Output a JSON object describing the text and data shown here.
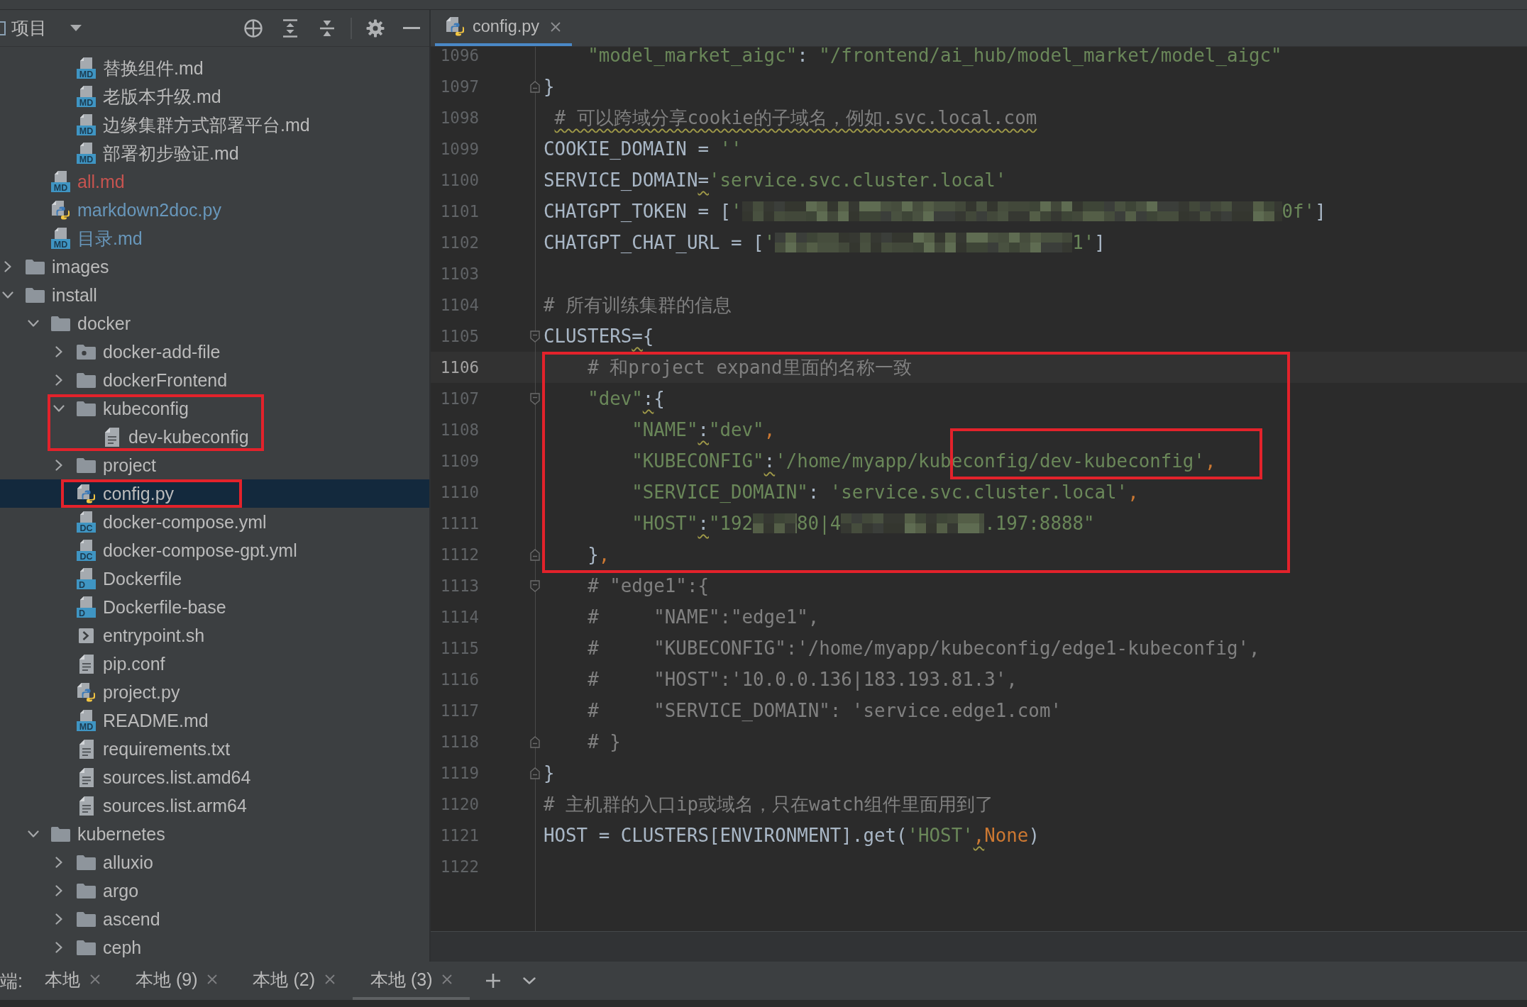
{
  "project_panel": {
    "title": "项目",
    "tree": [
      {
        "children": [
          {
            "children": [
              {
                "label": "替换组件.md",
                "kind": "md",
                "badge": "MD",
                "selected": false
              },
              {
                "label": "老版本升级.md",
                "kind": "md",
                "badge": "MD",
                "selected": false
              },
              {
                "label": "边缘集群方式部署平台.md",
                "kind": "md",
                "badge": "MD",
                "selected": false
              },
              {
                "label": "部署初步验证.md",
                "kind": "md",
                "badge": "MD",
                "selected": false
              }
            ]
          },
          {
            "label": "all.md",
            "kind": "md",
            "badge": "MD",
            "color": "#c75450",
            "selected": false
          },
          {
            "label": "markdown2doc.py",
            "kind": "py",
            "color": "#6897bb",
            "selected": false
          },
          {
            "label": "目录.md",
            "kind": "md",
            "badge": "MD",
            "color": "#6897bb",
            "selected": false
          }
        ]
      },
      {
        "label": "images",
        "kind": "folder",
        "expanded": false,
        "selected": false
      },
      {
        "label": "install",
        "kind": "folder",
        "expanded": true,
        "selected": false,
        "children": [
          {
            "label": "docker",
            "kind": "folder",
            "expanded": true,
            "selected": false,
            "children": [
              {
                "label": "docker-add-file",
                "kind": "folder-resource",
                "expanded": false,
                "selected": false
              },
              {
                "label": "dockerFrontend",
                "kind": "folder",
                "expanded": false,
                "selected": false
              },
              {
                "label": "kubeconfig",
                "kind": "folder",
                "expanded": true,
                "selected": false,
                "boxed": true,
                "children": [
                  {
                    "label": "dev-kubeconfig",
                    "kind": "text",
                    "selected": false
                  }
                ]
              },
              {
                "label": "project",
                "kind": "folder",
                "expanded": false,
                "selected": false
              },
              {
                "label": "config.py",
                "kind": "py",
                "selected": true,
                "boxed": true
              },
              {
                "label": "docker-compose.yml",
                "kind": "dc",
                "badge": "DC",
                "selected": false
              },
              {
                "label": "docker-compose-gpt.yml",
                "kind": "dc",
                "badge": "DC",
                "selected": false
              },
              {
                "label": "Dockerfile",
                "kind": "docker",
                "badge": "D",
                "selected": false
              },
              {
                "label": "Dockerfile-base",
                "kind": "docker",
                "badge": "D",
                "selected": false
              },
              {
                "label": "entrypoint.sh",
                "kind": "shell",
                "selected": false
              },
              {
                "label": "pip.conf",
                "kind": "text",
                "selected": false
              },
              {
                "label": "project.py",
                "kind": "py",
                "selected": false
              },
              {
                "label": "README.md",
                "kind": "md",
                "badge": "MD",
                "selected": false
              },
              {
                "label": "requirements.txt",
                "kind": "text",
                "selected": false
              },
              {
                "label": "sources.list.amd64",
                "kind": "text",
                "selected": false
              },
              {
                "label": "sources.list.arm64",
                "kind": "text",
                "selected": false
              }
            ]
          },
          {
            "label": "kubernetes",
            "kind": "folder",
            "expanded": true,
            "selected": false,
            "children": [
              {
                "label": "alluxio",
                "kind": "folder",
                "expanded": false,
                "selected": false
              },
              {
                "label": "argo",
                "kind": "folder",
                "expanded": false,
                "selected": false
              },
              {
                "label": "ascend",
                "kind": "folder",
                "expanded": false,
                "selected": false
              },
              {
                "label": "ceph",
                "kind": "folder",
                "expanded": false,
                "selected": false
              }
            ]
          }
        ]
      }
    ]
  },
  "editor": {
    "tabs": [
      {
        "label": "config.py",
        "kind": "py",
        "selected": true
      }
    ],
    "blocks": [
      {
        "lines": [
          {
            "number": "1096",
            "current": false,
            "tokens": [
              {
                "kind": "string",
                "text": "    \"model_market_aigc\""
              },
              {
                "kind": "plain",
                "text": ": "
              },
              {
                "kind": "string",
                "text": "\"/frontend/ai_hub/model_market/model_aigc\""
              }
            ]
          },
          {
            "number": "1097",
            "current": false,
            "fold_end": true,
            "tokens": [
              {
                "kind": "plain",
                "text": "}"
              }
            ]
          },
          {
            "number": "1098",
            "current": false,
            "tokens": [
              {
                "kind": "comment",
                "text": " # 可以跨域分享cookie的子域名，例如.svc.local.com",
                "warning": true
              }
            ]
          },
          {
            "number": "1099",
            "current": false,
            "tokens": [
              {
                "kind": "plain",
                "text": "COOKIE_DOMAIN = "
              },
              {
                "kind": "string",
                "text": "''"
              }
            ]
          },
          {
            "number": "1100",
            "current": false,
            "tokens": [
              {
                "kind": "plain",
                "text": "SERVICE_DOMAIN"
              },
              {
                "kind": "plain",
                "text": "=",
                "warning": true
              },
              {
                "kind": "string",
                "text": "'service.svc.cluster.local'"
              }
            ]
          },
          {
            "number": "1101",
            "current": false,
            "tokens": [
              {
                "kind": "plain",
                "text": "CHATGPT_TOKEN = ["
              },
              {
                "kind": "string",
                "text": "'"
              },
              {
                "kind": "redacted"
              },
              {
                "kind": "string",
                "text": "0f'"
              },
              {
                "kind": "plain",
                "text": "]"
              }
            ]
          },
          {
            "number": "1102",
            "current": false,
            "tokens": [
              {
                "kind": "plain",
                "text": "CHATGPT_CHAT_URL = ["
              },
              {
                "kind": "string",
                "text": "'"
              },
              {
                "kind": "redacted"
              },
              {
                "kind": "string",
                "text": "1'"
              },
              {
                "kind": "plain",
                "text": "]"
              }
            ]
          },
          {
            "number": "1103",
            "current": false
          },
          {
            "number": "1104",
            "current": false,
            "tokens": [
              {
                "kind": "comment",
                "text": "# 所有训练集群的信息"
              }
            ]
          },
          {
            "number": "1105",
            "current": false,
            "fold_start": true,
            "tokens": [
              {
                "kind": "plain",
                "text": "CLUSTERS"
              },
              {
                "kind": "plain",
                "text": "=",
                "warning": true
              },
              {
                "kind": "plain",
                "text": "{"
              }
            ]
          }
        ]
      },
      {
        "boxed": true,
        "lines": [
          {
            "number": "1106",
            "current": true,
            "tokens": [
              {
                "kind": "comment",
                "text": "    # 和project expand里面的名称一致"
              }
            ]
          },
          {
            "number": "1107",
            "current": false,
            "fold_start": true,
            "tokens": [
              {
                "kind": "string",
                "text": "    \"dev\""
              },
              {
                "kind": "plain",
                "text": ":",
                "warning": true
              },
              {
                "kind": "plain",
                "text": "{"
              }
            ]
          },
          {
            "number": "1108",
            "current": false,
            "tokens": [
              {
                "kind": "string",
                "text": "        \"NAME\""
              },
              {
                "kind": "plain",
                "text": ":",
                "warning": true
              },
              {
                "kind": "string",
                "text": "\"dev\""
              },
              {
                "kind": "keyword",
                "text": ","
              }
            ]
          },
          {
            "number": "1109",
            "current": false,
            "tokens": [
              {
                "kind": "string",
                "text": "        \"KUBECONFIG\""
              },
              {
                "kind": "plain",
                "text": ":",
                "warning": true
              },
              {
                "kind": "string",
                "text": "'/home/myapp/kub"
              },
              {
                "kind": "group",
                "boxed": true,
                "tokens": [
                  {
                    "kind": "string",
                    "text": "econfig/dev-kubeconfig'"
                  },
                  {
                    "kind": "keyword",
                    "text": ","
                  }
                ]
              }
            ]
          },
          {
            "number": "1110",
            "current": false,
            "tokens": [
              {
                "kind": "string",
                "text": "        \"SERVICE_DOMAIN\""
              },
              {
                "kind": "plain",
                "text": ": "
              },
              {
                "kind": "string",
                "text": "'service.svc.cluster.local'"
              },
              {
                "kind": "keyword",
                "text": ","
              }
            ]
          },
          {
            "number": "1111",
            "current": false,
            "tokens": [
              {
                "kind": "string",
                "text": "        \"HOST\""
              },
              {
                "kind": "plain",
                "text": ":",
                "warning": true
              },
              {
                "kind": "string",
                "text": "\"192"
              },
              {
                "kind": "redacted"
              },
              {
                "kind": "string",
                "text": "80|4"
              },
              {
                "kind": "redacted"
              },
              {
                "kind": "string",
                "text": ".197:8888\""
              }
            ]
          },
          {
            "number": "1112",
            "current": false,
            "fold_end": true,
            "tokens": [
              {
                "kind": "plain",
                "text": "    }"
              },
              {
                "kind": "keyword",
                "text": ","
              }
            ]
          }
        ]
      },
      {
        "lines": [
          {
            "number": "1113",
            "current": false,
            "fold_start": true,
            "tokens": [
              {
                "kind": "comment",
                "text": "    # \"edge1\":{"
              }
            ]
          },
          {
            "number": "1114",
            "current": false,
            "tokens": [
              {
                "kind": "comment",
                "text": "    #     \"NAME\":\"edge1\","
              }
            ]
          },
          {
            "number": "1115",
            "current": false,
            "tokens": [
              {
                "kind": "comment",
                "text": "    #     \"KUBECONFIG\":'/home/myapp/kubeconfig/edge1-kubeconfig',"
              }
            ]
          },
          {
            "number": "1116",
            "current": false,
            "tokens": [
              {
                "kind": "comment",
                "text": "    #     \"HOST\":'10.0.0.136|183.193.81.3',"
              }
            ]
          },
          {
            "number": "1117",
            "current": false,
            "tokens": [
              {
                "kind": "comment",
                "text": "    #     \"SERVICE_DOMAIN\": 'service.edge1.com'"
              }
            ]
          },
          {
            "number": "1118",
            "current": false,
            "fold_end": true,
            "tokens": [
              {
                "kind": "comment",
                "text": "    # }"
              }
            ]
          },
          {
            "number": "1119",
            "current": false,
            "fold_end": true,
            "tokens": [
              {
                "kind": "plain",
                "text": "}"
              }
            ]
          },
          {
            "number": "1120",
            "current": false,
            "tokens": [
              {
                "kind": "comment",
                "text": "# 主机群的入口ip或域名，只在watch组件里面用到了"
              }
            ]
          },
          {
            "number": "1121",
            "current": false,
            "tokens": [
              {
                "kind": "plain",
                "text": "HOST = CLUSTERS[ENVIRONMENT].get("
              },
              {
                "kind": "group",
                "tokens": [
                  {
                    "kind": "string",
                    "text": "'HOST'"
                  },
                  {
                    "kind": "keyword",
                    "text": ",",
                    "warning": true
                  }
                ]
              },
              {
                "kind": "keyword",
                "text": "None"
              },
              {
                "kind": "plain",
                "text": ")"
              }
            ]
          },
          {
            "number": "1122",
            "current": false
          }
        ]
      }
    ]
  },
  "terminal_bar": {
    "label": "端:",
    "tabs": [
      {
        "label": "本地",
        "selected": false
      },
      {
        "label": "本地 (9)",
        "selected": false
      },
      {
        "label": "本地 (2)",
        "selected": false
      },
      {
        "label": "本地 (3)",
        "selected": true
      }
    ]
  }
}
